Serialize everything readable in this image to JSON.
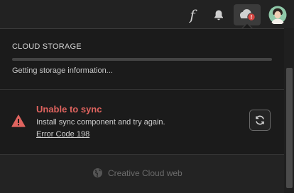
{
  "topbar": {
    "fonts_glyph": "f",
    "icons": [
      "fonts-icon",
      "bell-icon",
      "cloud-alert-icon",
      "avatar"
    ],
    "alert_glyph": "!"
  },
  "storage": {
    "title": "CLOUD STORAGE",
    "status": "Getting storage information...",
    "progress_percent": 0
  },
  "sync_error": {
    "title": "Unable to sync",
    "message": "Install sync component and try again.",
    "code_link": "Error Code 198",
    "icon": "warning-icon",
    "retry_icon": "refresh-icon"
  },
  "footer": {
    "web_link": "Creative Cloud web",
    "icon": "globe-icon"
  },
  "colors": {
    "error": "#e0645f",
    "alert_badge": "#d64541"
  }
}
